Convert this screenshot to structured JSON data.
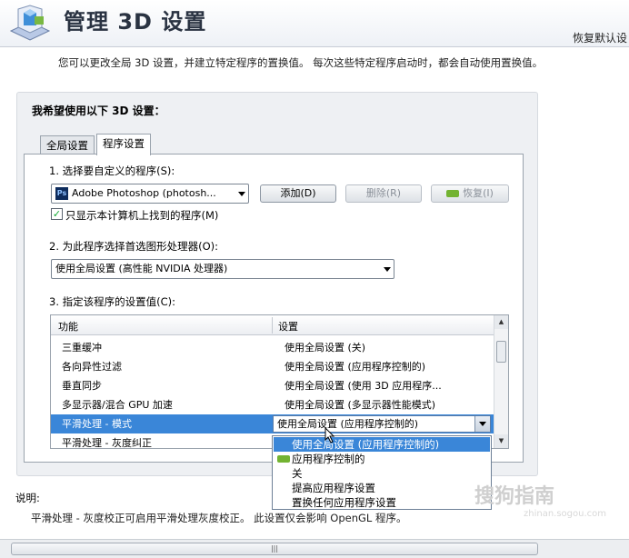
{
  "header": {
    "title": "管理 3D 设置",
    "restore_link": "恢复默认设"
  },
  "description": "您可以更改全局 3D 设置，并建立特定程序的置换值。 每次这些特定程序启动时，都会自动使用置换值。",
  "group_title": "我希望使用以下 3D 设置：",
  "tabs": [
    {
      "label": "全局设置",
      "active": false
    },
    {
      "label": "程序设置",
      "active": true
    }
  ],
  "step1": {
    "label": "1. 选择要自定义的程序(S):",
    "selected_program": "Adobe Photoshop (photosh...",
    "program_icon": "Ps",
    "add_button": "添加(D)",
    "remove_button": "删除(R)",
    "restore_button": "恢复(I)",
    "checkbox_label": "只显示本计算机上找到的程序(M)",
    "checkbox_checked": true
  },
  "step2": {
    "label": "2. 为此程序选择首选图形处理器(O):",
    "selected": "使用全局设置 (高性能 NVIDIA 处理器)"
  },
  "step3": {
    "label": "3. 指定该程序的设置值(C):",
    "col_feature": "功能",
    "col_setting": "设置",
    "rows": [
      {
        "feature": "三重缓冲",
        "setting": "使用全局设置 (关)"
      },
      {
        "feature": "各向异性过滤",
        "setting": "使用全局设置 (应用程序控制的)"
      },
      {
        "feature": "垂直同步",
        "setting": "使用全局设置 (使用 3D 应用程序..."
      },
      {
        "feature": "多显示器/混合 GPU 加速",
        "setting": "使用全局设置 (多显示器性能模式)"
      },
      {
        "feature": "平滑处理 - 模式",
        "setting": "使用全局设置 (应用程序控制的)"
      },
      {
        "feature": "平滑处理 - 灰度纠正",
        "setting": ""
      }
    ],
    "selected_row_index": 4,
    "dropdown_options": [
      "使用全局设置 (应用程序控制的)",
      "应用程序控制的",
      "关",
      "提高应用程序设置",
      "置换任何应用程序设置"
    ],
    "highlighted_option_index": 0
  },
  "help": {
    "title": "说明:",
    "text": "平滑处理 - 灰度校正可启用平滑处理灰度校正。 此设置仅会影响 OpenGL 程序。"
  },
  "watermark": {
    "text": "搜狗指南",
    "sub": "zhinan.sogou.com"
  },
  "colors": {
    "selection": "#3a86d8",
    "nvidia_green": "#73b332"
  }
}
